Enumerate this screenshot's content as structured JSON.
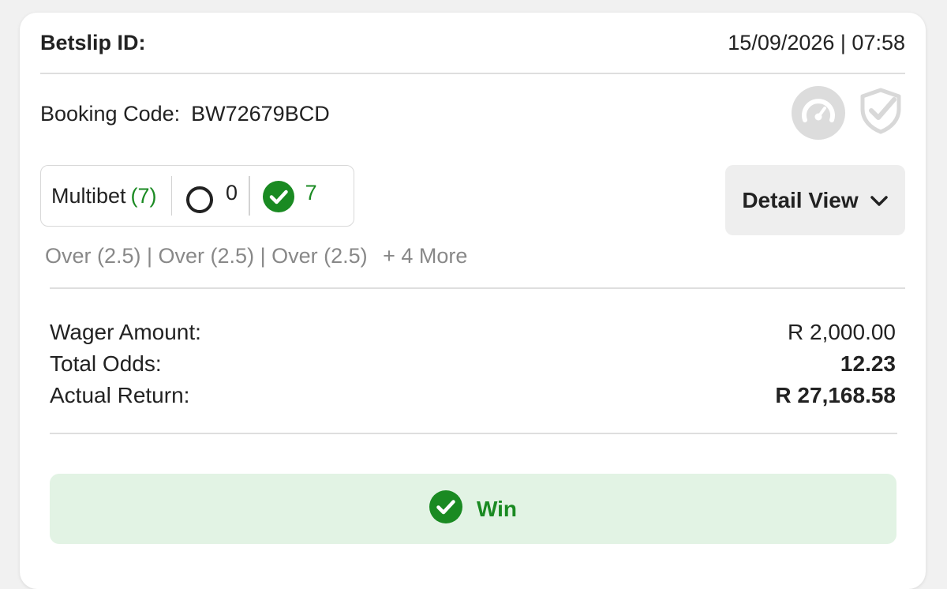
{
  "header": {
    "betslip_label": "Betslip ID:",
    "datetime": "15/09/2026 | 07:58"
  },
  "booking": {
    "label": "Booking Code:",
    "code": "BW72679BCD"
  },
  "status_icons": [
    "gauge-icon",
    "shield-check-icon"
  ],
  "summary": {
    "type_label": "Multibet",
    "total_count": "(7)",
    "open_count": "0",
    "won_count": "7"
  },
  "detail_button": {
    "label": "Detail View",
    "icon": "chevron-down-icon"
  },
  "selections": {
    "text": "Over (2.5) | Over (2.5) | Over (2.5)",
    "more": "+ 4 More"
  },
  "amounts": {
    "wager_label": "Wager Amount:",
    "wager_value": "R 2,000.00",
    "odds_label": "Total Odds:",
    "odds_value": "12.23",
    "return_label": "Actual Return:",
    "return_value": "R 27,168.58"
  },
  "result": {
    "label": "Win",
    "icon": "check-circle-icon"
  },
  "colors": {
    "win_green": "#1a8a22",
    "win_bg": "#e2f3e4",
    "muted_icon": "#dcdcdc"
  }
}
